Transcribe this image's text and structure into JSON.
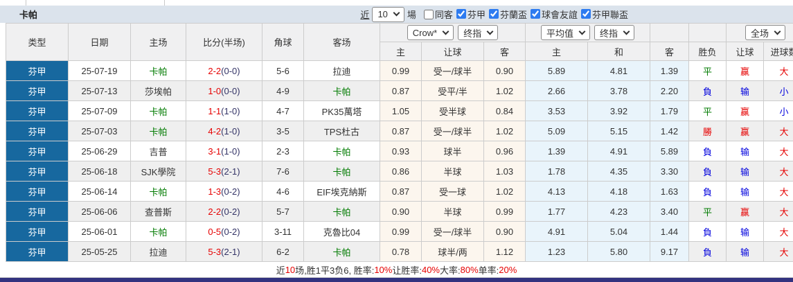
{
  "title_bar": {
    "team": "卡帕",
    "recent_label": "近",
    "recent_count": "10",
    "games_label": "場",
    "same_away": {
      "label": "同客",
      "checked": false
    },
    "filters": [
      {
        "label": "芬甲",
        "checked": true
      },
      {
        "label": "芬蘭盃",
        "checked": true
      },
      {
        "label": "球會友誼",
        "checked": true
      },
      {
        "label": "芬甲聯盃",
        "checked": true
      }
    ]
  },
  "table": {
    "columns": [
      "类型",
      "日期",
      "主场",
      "比分(半场)",
      "角球",
      "客场"
    ],
    "selectors": {
      "bookmaker": "Crow*",
      "handicap_final": "终指",
      "average": "平均值",
      "europe_final": "终指",
      "scope": "全场"
    },
    "sub_headers": [
      "主",
      "让球",
      "客",
      "主",
      "和",
      "客",
      "胜负",
      "让球",
      "进球数"
    ],
    "rows": [
      {
        "league": "芬甲",
        "date": "25-07-19",
        "home": "卡帕",
        "score_ft": "2-2",
        "score_ht": "(0-0)",
        "corners": "5-6",
        "away": "拉迪",
        "let_home": "0.99",
        "handicap": "受一/球半",
        "let_away": "0.90",
        "avg_home": "5.89",
        "avg_draw": "4.81",
        "avg_away": "1.39",
        "result": "平",
        "handicap_result": "赢",
        "goals": "大"
      },
      {
        "league": "芬甲",
        "date": "25-07-13",
        "home": "莎埃帕",
        "score_ft": "1-0",
        "score_ht": "(0-0)",
        "corners": "4-9",
        "away": "卡帕",
        "let_home": "0.87",
        "handicap": "受平/半",
        "let_away": "1.02",
        "avg_home": "2.66",
        "avg_draw": "3.78",
        "avg_away": "2.20",
        "result": "負",
        "handicap_result": "输",
        "goals": "小"
      },
      {
        "league": "芬甲",
        "date": "25-07-09",
        "home": "卡帕",
        "score_ft": "1-1",
        "score_ht": "(1-0)",
        "corners": "4-7",
        "away": "PK35萬塔",
        "let_home": "1.05",
        "handicap": "受半球",
        "let_away": "0.84",
        "avg_home": "3.53",
        "avg_draw": "3.92",
        "avg_away": "1.79",
        "result": "平",
        "handicap_result": "赢",
        "goals": "小"
      },
      {
        "league": "芬甲",
        "date": "25-07-03",
        "home": "卡帕",
        "score_ft": "4-2",
        "score_ht": "(1-0)",
        "corners": "3-5",
        "away": "TPS杜古",
        "let_home": "0.87",
        "handicap": "受一/球半",
        "let_away": "1.02",
        "avg_home": "5.09",
        "avg_draw": "5.15",
        "avg_away": "1.42",
        "result": "勝",
        "handicap_result": "赢",
        "goals": "大"
      },
      {
        "league": "芬甲",
        "date": "25-06-29",
        "home": "吉普",
        "score_ft": "3-1",
        "score_ht": "(1-0)",
        "corners": "2-3",
        "away": "卡帕",
        "let_home": "0.93",
        "handicap": "球半",
        "let_away": "0.96",
        "avg_home": "1.39",
        "avg_draw": "4.91",
        "avg_away": "5.89",
        "result": "負",
        "handicap_result": "输",
        "goals": "大"
      },
      {
        "league": "芬甲",
        "date": "25-06-18",
        "home": "SJK學院",
        "score_ft": "5-3",
        "score_ht": "(2-1)",
        "corners": "7-6",
        "away": "卡帕",
        "let_home": "0.86",
        "handicap": "半球",
        "let_away": "1.03",
        "avg_home": "1.78",
        "avg_draw": "4.35",
        "avg_away": "3.30",
        "result": "負",
        "handicap_result": "输",
        "goals": "大"
      },
      {
        "league": "芬甲",
        "date": "25-06-14",
        "home": "卡帕",
        "score_ft": "1-3",
        "score_ht": "(0-2)",
        "corners": "4-6",
        "away": "EIF埃克納斯",
        "let_home": "0.87",
        "handicap": "受一球",
        "let_away": "1.02",
        "avg_home": "4.13",
        "avg_draw": "4.18",
        "avg_away": "1.63",
        "result": "負",
        "handicap_result": "输",
        "goals": "大"
      },
      {
        "league": "芬甲",
        "date": "25-06-06",
        "home": "查普斯",
        "score_ft": "2-2",
        "score_ht": "(0-2)",
        "corners": "5-7",
        "away": "卡帕",
        "let_home": "0.90",
        "handicap": "半球",
        "let_away": "0.99",
        "avg_home": "1.77",
        "avg_draw": "4.23",
        "avg_away": "3.40",
        "result": "平",
        "handicap_result": "赢",
        "goals": "大"
      },
      {
        "league": "芬甲",
        "date": "25-06-01",
        "home": "卡帕",
        "score_ft": "0-5",
        "score_ht": "(0-2)",
        "corners": "3-11",
        "away": "克魯比04",
        "let_home": "0.99",
        "handicap": "受一/球半",
        "let_away": "0.90",
        "avg_home": "4.91",
        "avg_draw": "5.04",
        "avg_away": "1.44",
        "result": "負",
        "handicap_result": "输",
        "goals": "大"
      },
      {
        "league": "芬甲",
        "date": "25-05-25",
        "home": "拉迪",
        "score_ft": "5-3",
        "score_ht": "(2-1)",
        "corners": "6-2",
        "away": "卡帕",
        "let_home": "0.78",
        "handicap": "球半/两",
        "let_away": "1.12",
        "avg_home": "1.23",
        "avg_draw": "5.80",
        "avg_away": "9.17",
        "result": "負",
        "handicap_result": "输",
        "goals": "大"
      }
    ]
  },
  "footer": {
    "segments": [
      {
        "text": "近",
        "red": false
      },
      {
        "text": "10",
        "red": true
      },
      {
        "text": "场,胜1平3负6, 胜率:",
        "red": false
      },
      {
        "text": "10%",
        "red": true
      },
      {
        "text": " 让胜率:",
        "red": false
      },
      {
        "text": "40%",
        "red": true
      },
      {
        "text": " 大率:",
        "red": false
      },
      {
        "text": "80%",
        "red": true
      },
      {
        "text": " 单率:",
        "red": false
      },
      {
        "text": "20%",
        "red": true
      }
    ]
  },
  "value_colors": {
    "勝": "#e60000",
    "平": "#007b00",
    "負": "#0000dd",
    "赢": "#e60000",
    "输": "#0000dd",
    "大": "#e60000",
    "小": "#0000dd"
  },
  "colors": {
    "league_cell_bg": "#17689f",
    "self_team_green": "#007b00",
    "score_red": "#e60000",
    "checkbox_blue": "#2d7bf0",
    "bottom_bar": "#32327f",
    "title_bar_bg": "#dbe3ec"
  }
}
